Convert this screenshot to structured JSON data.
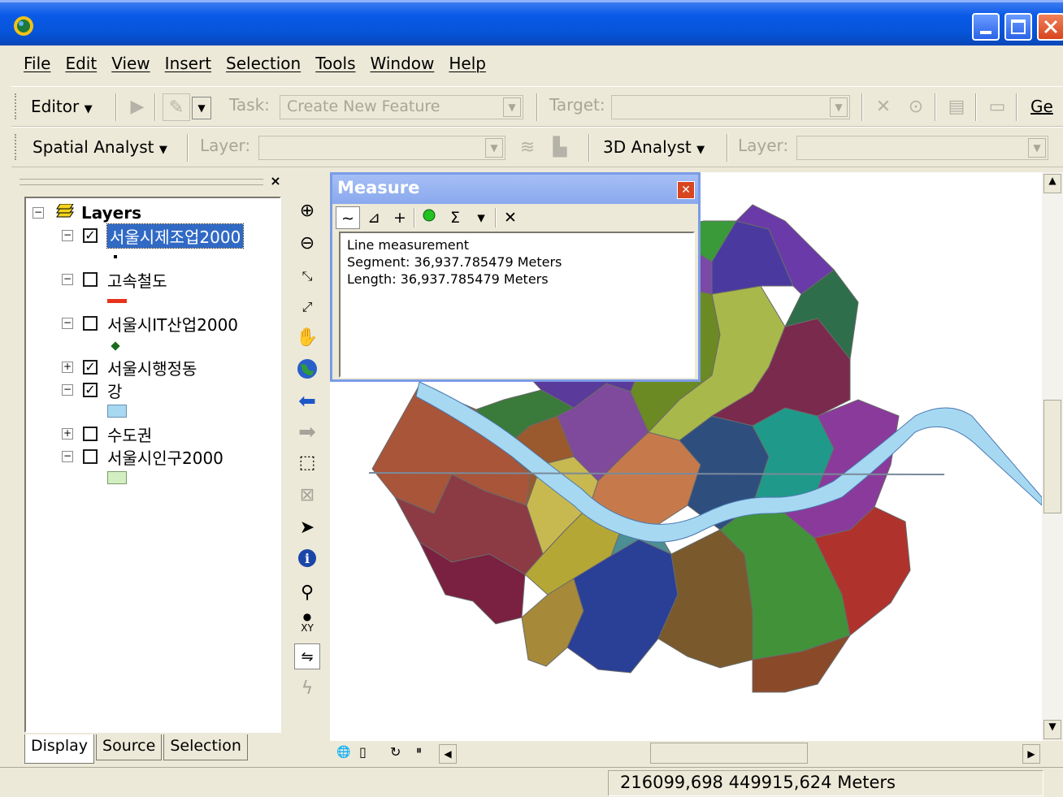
{
  "window": {
    "app_icon": "globe-icon",
    "controls": [
      "minimize-icon",
      "maximize-icon",
      "close-icon"
    ]
  },
  "menu": [
    "File",
    "Edit",
    "View",
    "Insert",
    "Selection",
    "Tools",
    "Window",
    "Help"
  ],
  "editor_toolbar": {
    "editor_label": "Editor",
    "task_label": "Task:",
    "task_value": "Create New Feature",
    "target_label": "Target:",
    "target_value": "",
    "overflow_label": "Ge"
  },
  "analyst_toolbar": {
    "spatial_label": "Spatial Analyst",
    "layer_label": "Layer:",
    "analyst3d_label": "3D Analyst",
    "layer2_label": "Layer:"
  },
  "toc": {
    "root_label": "Layers",
    "layers": [
      {
        "name": "서울시제조업2000",
        "checked": true,
        "expanded": true,
        "selected": true,
        "symbol": "dot"
      },
      {
        "name": "고속철도",
        "checked": false,
        "expanded": true,
        "symbol": "line",
        "color": "#e8331c"
      },
      {
        "name": "서울시IT산업2000",
        "checked": false,
        "expanded": true,
        "symbol": "point",
        "color": "#1a6b1a"
      },
      {
        "name": "서울시행정동",
        "checked": true,
        "expanded": false
      },
      {
        "name": "강",
        "checked": true,
        "expanded": true,
        "symbol": "fill",
        "color": "#a6d8f2"
      },
      {
        "name": "수도권",
        "checked": false,
        "expanded": false
      },
      {
        "name": "서울시인구2000",
        "checked": false,
        "expanded": true,
        "symbol": "fill",
        "color": "#d3efc2"
      }
    ],
    "tabs": [
      "Display",
      "Source",
      "Selection"
    ]
  },
  "tools": [
    "zoom-in-icon",
    "zoom-out-icon",
    "fixed-zoom-in-icon",
    "fixed-zoom-out-icon",
    "pan-icon",
    "full-extent-icon",
    "back-extent-icon",
    "forward-extent-icon",
    "select-features-icon",
    "clear-selection-icon",
    "select-elements-icon",
    "identify-icon",
    "find-icon",
    "go-to-xy-icon",
    "measure-icon",
    "hyperlink-icon"
  ],
  "measure": {
    "title": "Measure",
    "tool_icons": [
      "measure-line-icon",
      "measure-area-icon",
      "measure-feature-icon",
      "snapping-icon",
      "sum-icon",
      "units-icon",
      "clear-icon"
    ],
    "mode": "Line measurement",
    "segment": "Segment: 36,937.785479 Meters",
    "length": "Length: 36,937.785479 Meters"
  },
  "status": {
    "coords": "216099,698  449915,624 Meters"
  },
  "map_colors": {
    "river": "#a6d8f2"
  }
}
